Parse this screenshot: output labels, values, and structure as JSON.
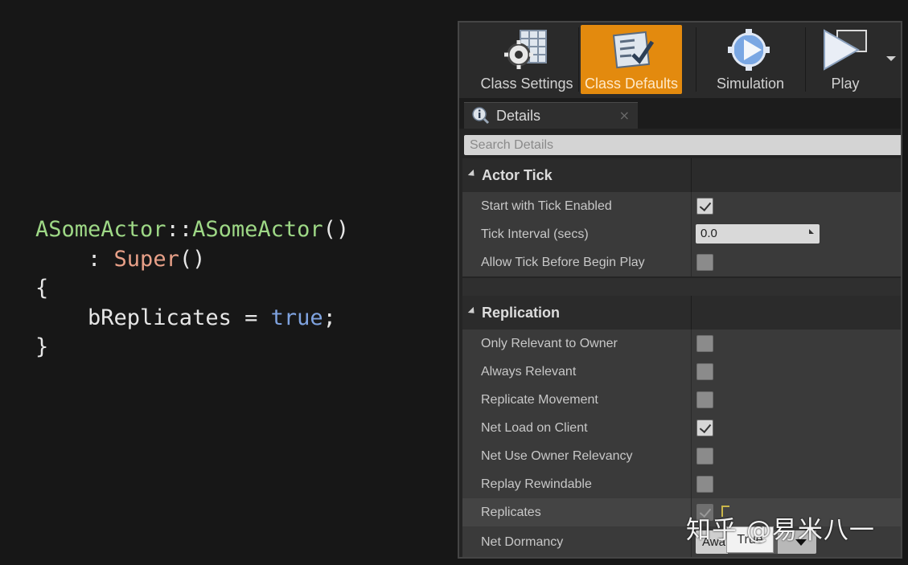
{
  "code": {
    "lines": [
      [
        {
          "t": "ASomeActor",
          "c": "green"
        },
        {
          "t": "::",
          "c": "white"
        },
        {
          "t": "ASomeActor",
          "c": "green"
        },
        {
          "t": "()",
          "c": "white"
        }
      ],
      [
        {
          "t": "    : ",
          "c": "white"
        },
        {
          "t": "Super",
          "c": "salmon"
        },
        {
          "t": "()",
          "c": "white"
        }
      ],
      [
        {
          "t": "{",
          "c": "white"
        }
      ],
      [
        {
          "t": "    bReplicates = ",
          "c": "white"
        },
        {
          "t": "true",
          "c": "blue"
        },
        {
          "t": ";",
          "c": "white"
        }
      ],
      [
        {
          "t": "}",
          "c": "white"
        }
      ]
    ]
  },
  "toolbar": {
    "class_settings_label": "Class Settings",
    "class_defaults_label": "Class Defaults",
    "simulation_label": "Simulation",
    "play_label": "Play",
    "active": "class-defaults",
    "accent_color": "#e38a0e"
  },
  "tab": {
    "label": "Details"
  },
  "search": {
    "placeholder": "Search Details"
  },
  "actor_tick": {
    "title": "Actor Tick",
    "start_with_tick_enabled": {
      "label": "Start with Tick Enabled",
      "checked": true
    },
    "tick_interval": {
      "label": "Tick Interval (secs)",
      "value": "0.0"
    },
    "allow_tick_before_begin_play": {
      "label": "Allow Tick Before Begin Play",
      "checked": false
    }
  },
  "replication": {
    "title": "Replication",
    "only_relevant_to_owner": {
      "label": "Only Relevant to Owner",
      "checked": false
    },
    "always_relevant": {
      "label": "Always Relevant",
      "checked": false
    },
    "replicate_movement": {
      "label": "Replicate Movement",
      "checked": false
    },
    "net_load_on_client": {
      "label": "Net Load on Client",
      "checked": true
    },
    "net_use_owner_relevancy": {
      "label": "Net Use Owner Relevancy",
      "checked": false
    },
    "replay_rewindable": {
      "label": "Replay Rewindable",
      "checked": false
    },
    "replicates": {
      "label": "Replicates",
      "checked": true
    },
    "net_dormancy": {
      "label": "Net Dormancy",
      "value": "Awa"
    }
  },
  "tooltip": {
    "text": "True"
  },
  "watermark": {
    "text": "知乎 @易米八一"
  }
}
